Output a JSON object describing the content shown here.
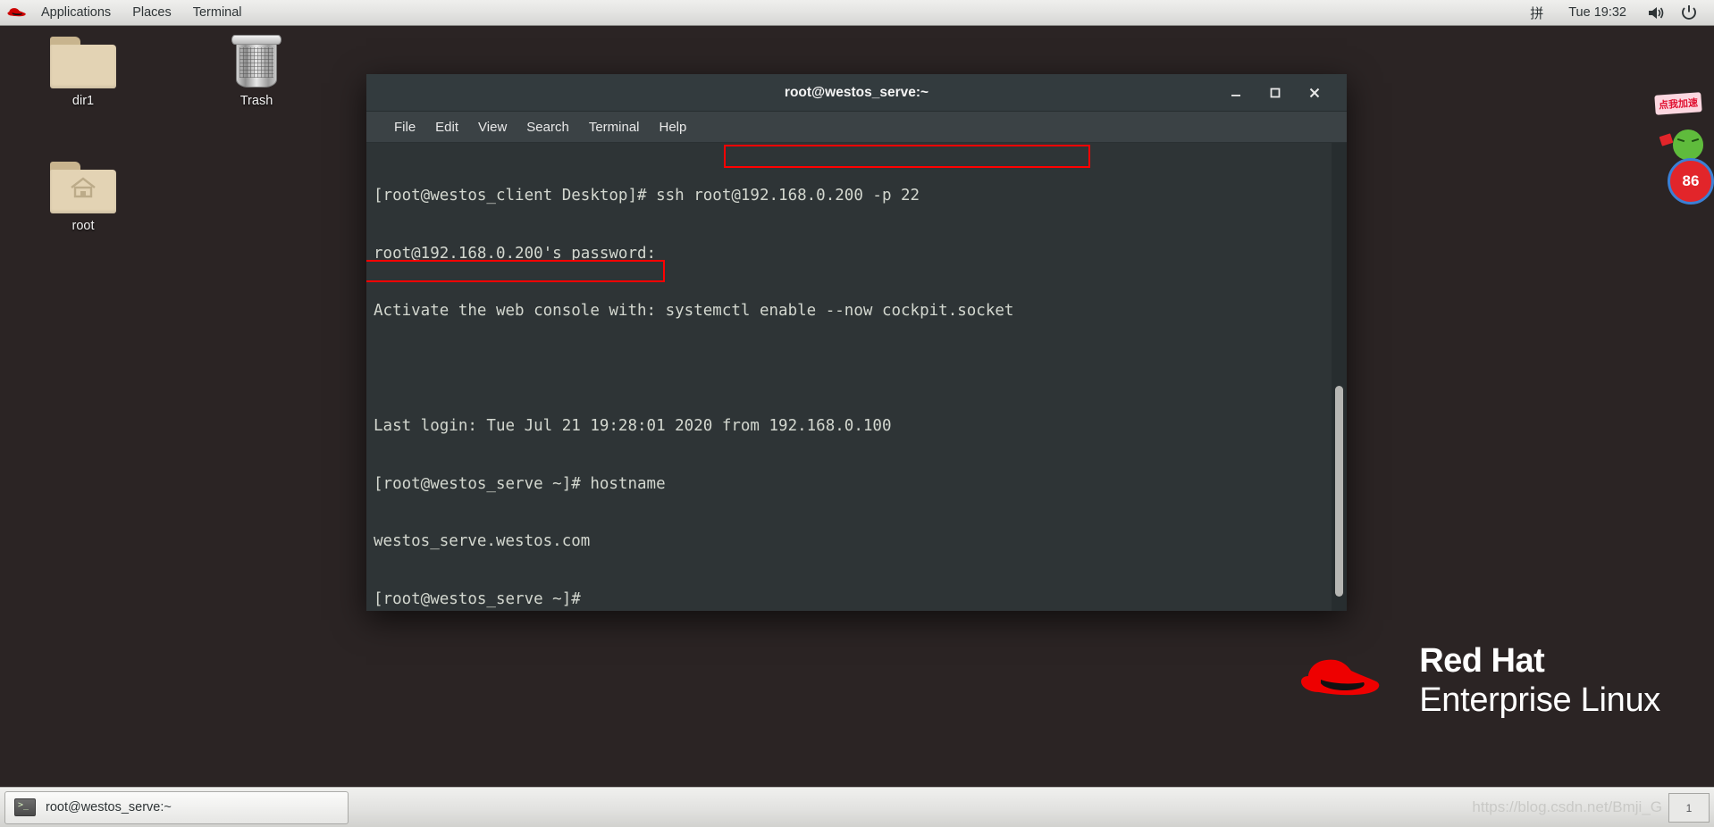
{
  "top_panel": {
    "logo_icon": "redhat-logo-icon",
    "menus": [
      "Applications",
      "Places",
      "Terminal"
    ],
    "ime_indicator": "拼",
    "clock": "Tue 19:32",
    "volume_icon": "volume-icon",
    "power_icon": "power-icon"
  },
  "desktop": {
    "icons": [
      {
        "label": "dir1",
        "type": "folder"
      },
      {
        "label": "Trash",
        "type": "trash"
      },
      {
        "label": "root",
        "type": "home-folder"
      }
    ],
    "branding": {
      "line1": "Red Hat",
      "line2": "Enterprise Linux"
    }
  },
  "terminal": {
    "title": "root@westos_serve:~",
    "menu": [
      "File",
      "Edit",
      "View",
      "Search",
      "Terminal",
      "Help"
    ],
    "window_buttons": {
      "minimize": "minimize-icon",
      "maximize": "maximize-icon",
      "close": "close-icon"
    },
    "lines": [
      "[root@westos_client Desktop]# ssh root@192.168.0.200 -p 22",
      "root@192.168.0.200's password:",
      "Activate the web console with: systemctl enable --now cockpit.socket",
      "",
      "Last login: Tue Jul 21 19:28:01 2020 from 192.168.0.100",
      "[root@westos_serve ~]# hostname",
      "westos_serve.westos.com",
      "[root@westos_serve ~]#"
    ],
    "highlights": [
      {
        "name": "ssh-command-highlight",
        "text": "ssh root@192.168.0.200 -p 22",
        "color": "#ff0000"
      },
      {
        "name": "hostname-output-highlight",
        "text": "westos_serve.westos.com",
        "color": "#ff0000"
      }
    ]
  },
  "taskbar": {
    "task_label": "root@westos_serve:~",
    "task_icon": "terminal-icon",
    "watermark": "https://blog.csdn.net/Bmji_G",
    "workspace": "1"
  },
  "sticker": {
    "bubble_text": "点我加速",
    "badge_text": "86",
    "mascot_icon": "green-mascot-icon"
  }
}
